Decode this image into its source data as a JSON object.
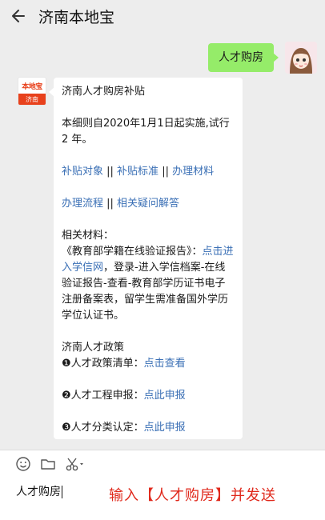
{
  "header": {
    "title": "济南本地宝"
  },
  "chat": {
    "sent_message": "人才购房",
    "received": {
      "avatar_top": "本地宝",
      "avatar_bottom": "济南",
      "title": "济南人才购房补贴",
      "intro": "本细则自2020年1月1日起实施,试行2 年。",
      "links_row1": {
        "link1": "补贴对象",
        "sep1": " || ",
        "link2": "补贴标准",
        "sep2": " || ",
        "link3": "办理材料"
      },
      "links_row2": {
        "link1": "办理流程",
        "sep1": " || ",
        "link2": "相关疑问解答"
      },
      "materials": {
        "label": "相关材料：",
        "text_before": "《教育部学籍在线验证报告》：",
        "link": "点击进入学信网",
        "text_after": "，登录-进入学信档案-在线验证报告-查看-教育部学历证书电子注册备案表，留学生需准备国外学历学位认证书。"
      },
      "policy": {
        "heading": "济南人才政策",
        "item1_label": "❶人才政策清单：",
        "item1_link": "点击查看",
        "item2_label": "❷人才工程申报：",
        "item2_link": "点此申报",
        "item3_label": "❸人才分类认定：",
        "item3_link": "点此申报"
      }
    }
  },
  "input": {
    "value": "人才购房",
    "annotation": "输入【人才购房】并发送"
  },
  "icons": {
    "back": "arrow-left-icon",
    "emoji": "emoji-icon",
    "folder": "folder-icon",
    "scissors": "scissors-icon"
  },
  "colors": {
    "background": "#ededed",
    "sent_bubble": "#95ec69",
    "link": "#3a6fb5",
    "annotation": "#e0291c",
    "brand": "#e8411c"
  }
}
